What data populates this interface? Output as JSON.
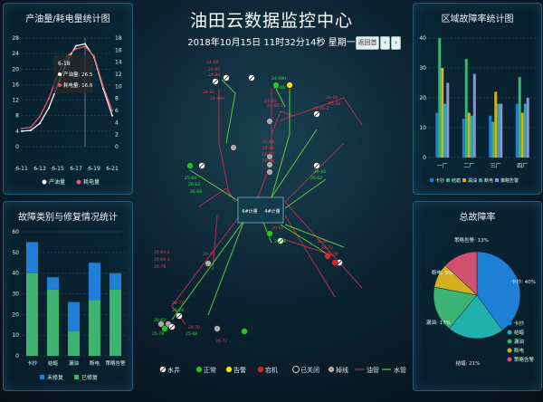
{
  "header": {
    "title": "油田云数据监控中心",
    "datetime": "2018年10月15日 11时32分14秒 星期一",
    "btn_return": "返回首",
    "btn_prev": "‹",
    "btn_next": "›"
  },
  "colors": {
    "accent": "#9fd4f0",
    "bar_blue": "#1e7fd6",
    "bar_green": "#3cb371",
    "line_red": "#e05a6a",
    "pipe_green": "#5ec73a",
    "pipe_red": "#b03050"
  },
  "charts": {
    "production": {
      "title": "产油量/耗电量统计图",
      "tooltip": {
        "date": "6-18",
        "oil_label": "产油量: 26.5",
        "power_label": "耗电量: 16.6"
      },
      "chart_data": {
        "type": "line",
        "x": [
          "6-11",
          "6-12",
          "6-13",
          "6-14",
          "6-15",
          "6-16",
          "6-17",
          "6-18",
          "6-19",
          "6-20",
          "6-21"
        ],
        "x_tick_labels": [
          "6-11",
          "6-13",
          "6-15",
          "6-17",
          "6-19",
          "6-21"
        ],
        "series": [
          {
            "name": "产油量",
            "color": "#ffffff",
            "axis": "left",
            "values": [
              4,
              4.2,
              6,
              10,
              16,
              22,
              26,
              26.5,
              23,
              15,
              8
            ]
          },
          {
            "name": "耗电量",
            "color": "#e05a6a",
            "axis": "right",
            "values": [
              3,
              3.2,
              5,
              8,
              12,
              15,
              16.2,
              16.6,
              15,
              10,
              6
            ]
          }
        ],
        "ylim_left": [
          0,
          28
        ],
        "yticks_left": [
          "0",
          "4",
          "8",
          "12",
          "16",
          "20",
          "24",
          "28"
        ],
        "ylim_right": [
          0,
          18
        ],
        "yticks_right": [
          "0",
          "2",
          "4",
          "6",
          "8",
          "10",
          "12",
          "14",
          "16",
          "18"
        ],
        "legend": [
          "产油量",
          "耗电量"
        ]
      }
    },
    "fault_type": {
      "title": "故障类别与修复情况统计",
      "chart_data": {
        "type": "bar",
        "categories": [
          "卡抄",
          "结蜡",
          "漏油",
          "断电",
          "策略告警"
        ],
        "series": [
          {
            "name": "未修复",
            "color": "#1e7fd6",
            "values": [
              15,
              6,
              14,
              18,
              8
            ]
          },
          {
            "name": "已修复",
            "color": "#3cb371",
            "values": [
              40,
              32,
              12,
              27,
              32
            ]
          }
        ],
        "stacked": true,
        "ylim": [
          0,
          60
        ],
        "yticks": [
          "0",
          "10",
          "20",
          "30",
          "40",
          "50",
          "60"
        ],
        "legend": [
          "未修复",
          "已修复"
        ]
      }
    },
    "region_fault": {
      "title": "区域故障率统计图",
      "chart_data": {
        "type": "bar",
        "categories": [
          "一厂",
          "二厂",
          "三厂",
          "四厂"
        ],
        "series": [
          {
            "name": "卡抄",
            "color": "#1e7fd6",
            "values": [
              15,
              13,
              14,
              18
            ]
          },
          {
            "name": "结蜡",
            "color": "#3cb371",
            "values": [
              40,
              33,
              12,
              27
            ]
          },
          {
            "name": "漏油",
            "color": "#d4b020",
            "values": [
              30,
              15,
              22,
              15
            ]
          },
          {
            "name": "断电",
            "color": "#20b2aa",
            "values": [
              18,
              14,
              18,
              18
            ]
          },
          {
            "name": "策略告警",
            "color": "#9090d8",
            "values": [
              25,
              28,
              18,
              20
            ]
          }
        ],
        "ylim": [
          0,
          40
        ],
        "yticks": [
          "0",
          "10",
          "20",
          "30",
          "40"
        ],
        "legend": [
          "卡抄",
          "结蜡",
          "漏油",
          "断电",
          "策略告警"
        ]
      }
    },
    "total_fault": {
      "title": "总故障率",
      "chart_data": {
        "type": "pie",
        "slices": [
          {
            "label": "卡抄: 40%",
            "name": "卡抄",
            "value": 40,
            "color": "#1e7fd6"
          },
          {
            "label": "结蜡: 21%",
            "name": "结蜡",
            "value": 21,
            "color": "#20b2aa"
          },
          {
            "label": "漏油: 17%",
            "name": "漏油",
            "value": 17,
            "color": "#3cb371"
          },
          {
            "label": "断电: 9%",
            "name": "断电",
            "value": 9,
            "color": "#d4b020"
          },
          {
            "label": "策略告警: 13%",
            "name": "策略告警",
            "value": 13,
            "color": "#d05070"
          }
        ],
        "legend": [
          "卡抄",
          "结蜡",
          "漏油",
          "断电",
          "策略告警"
        ]
      }
    }
  },
  "map": {
    "hub_labels": [
      "6#计量",
      "4#计量"
    ],
    "well_labels": [
      "24-68",
      "24-80",
      "24-86",
      "24-82",
      "24-86H",
      "24-68H",
      "26-66",
      "24-84",
      "24-66-2",
      "26-66",
      "25-68",
      "26-66-2",
      "26-68",
      "24-60",
      "26-72",
      "28-84",
      "25-64",
      "26-62",
      "26-68",
      "26-60",
      "26-62",
      "26-61",
      "25-68",
      "26-60-2",
      "26-66-3",
      "26-76",
      "26-74",
      "30-66",
      "28-72",
      "26-78",
      "28-75",
      "28-76",
      "28-62",
      "25-78",
      "26-70",
      "25-68",
      "26-72",
      "30-670",
      "30-872",
      "28-872"
    ],
    "legend": [
      {
        "icon": "水井",
        "label": "水井"
      },
      {
        "icon": "正常",
        "label": "正常"
      },
      {
        "icon": "告警",
        "label": "告警"
      },
      {
        "icon": "宕机",
        "label": "宕机"
      },
      {
        "icon": "已关闭",
        "label": "已关闭"
      },
      {
        "icon": "掉线",
        "label": "掉线"
      },
      {
        "icon": "油管",
        "label": "油管"
      },
      {
        "icon": "水管",
        "label": "水管"
      }
    ]
  }
}
